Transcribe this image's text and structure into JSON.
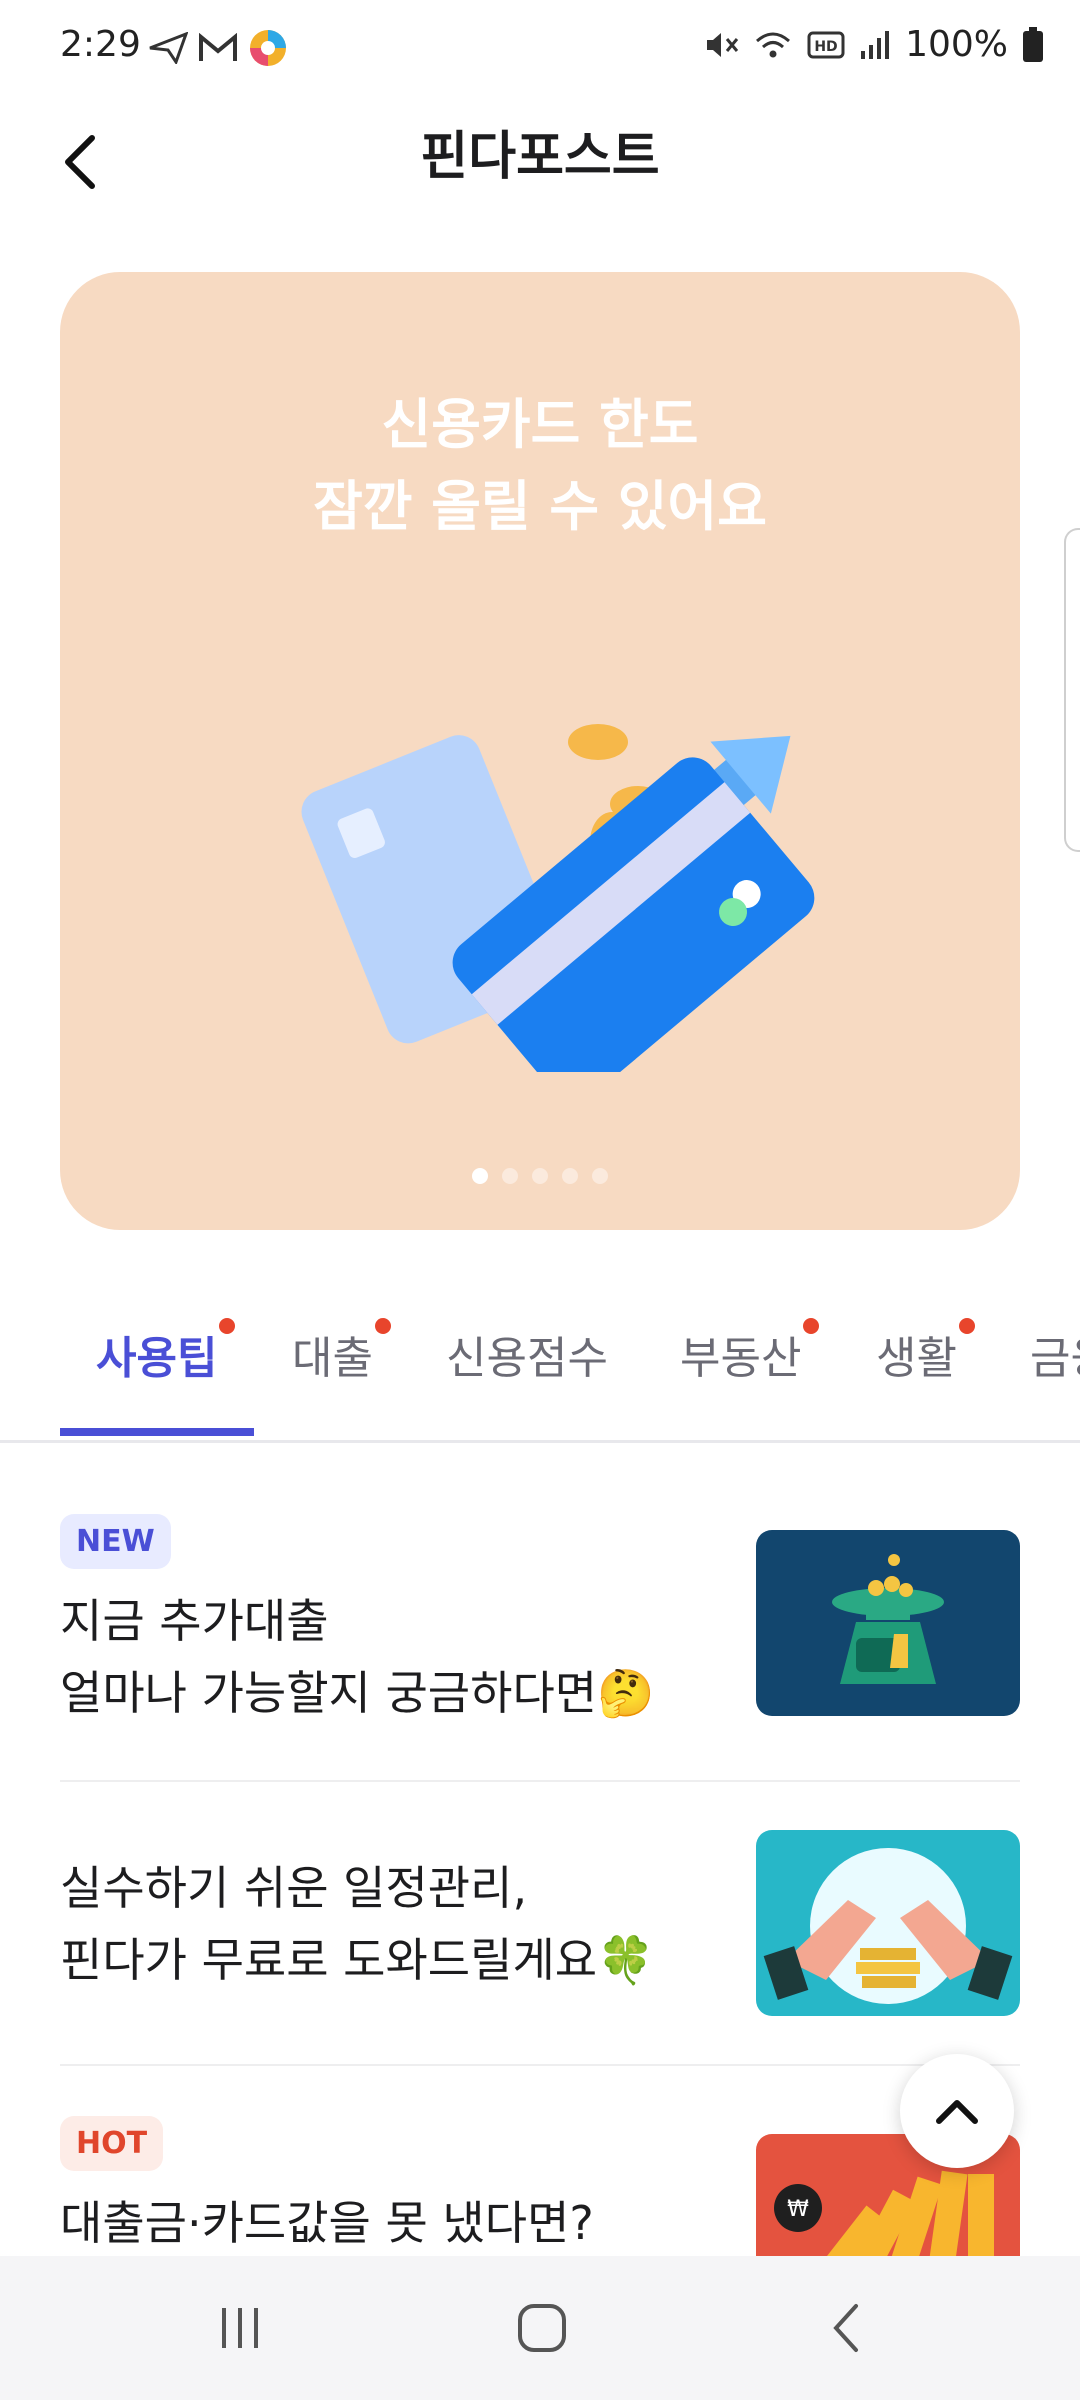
{
  "status_bar": {
    "time": "2:29",
    "battery": "100%",
    "icons": [
      "send-icon",
      "gmail-icon",
      "app-icon",
      "mute-icon",
      "wifi-icon",
      "hd-icon",
      "signal-icon",
      "battery-icon"
    ]
  },
  "header": {
    "title": "핀다포스트",
    "back_icon": "back-arrow-icon"
  },
  "banner": {
    "line1": "신용카드 한도",
    "line2": "잠깐 올릴 수 있어요",
    "illustration": "credit-card-arrow-illustration",
    "page_count": 5,
    "active_page": 1,
    "background": "#f7dac2"
  },
  "tabs": [
    {
      "label": "사용팁",
      "active": true,
      "dot": true
    },
    {
      "label": "대출",
      "active": false,
      "dot": true
    },
    {
      "label": "신용점수",
      "active": false,
      "dot": false
    },
    {
      "label": "부동산",
      "active": false,
      "dot": true
    },
    {
      "label": "생활",
      "active": false,
      "dot": true
    },
    {
      "label": "금융",
      "active": false,
      "dot": false
    }
  ],
  "articles": [
    {
      "badge": "NEW",
      "line1": "지금 추가대출",
      "line2": "얼마나 가능할지 궁금하다면🤔",
      "thumb": "scale-coins-thumbnail"
    },
    {
      "badge": "",
      "line1": "실수하기 쉬운 일정관리,",
      "line2": "핀다가 무료로 도와드릴게요🍀",
      "thumb": "hands-coins-thumbnail"
    },
    {
      "badge": "HOT",
      "line1": "대출금·카드값을 못 냈다면?",
      "line2": "",
      "thumb": "dominoes-thumbnail"
    }
  ],
  "colors": {
    "accent": "#4a4fd6",
    "red_dot": "#e8452c"
  }
}
